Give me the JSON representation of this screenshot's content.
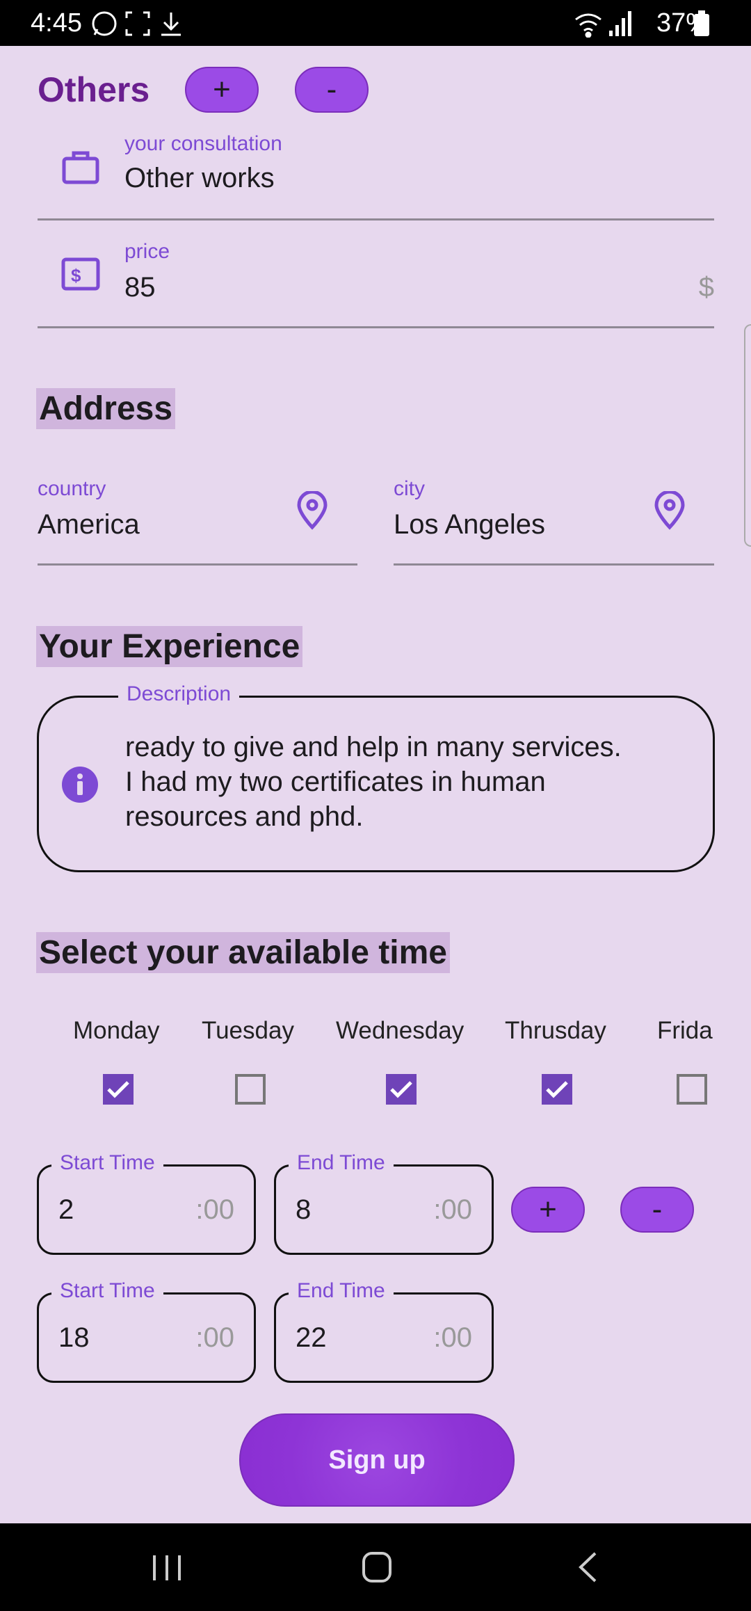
{
  "status_bar": {
    "time": "4:45",
    "battery": "37%"
  },
  "others": {
    "title": "Others",
    "add_label": "+",
    "remove_label": "-"
  },
  "consultation": {
    "label": "your consultation",
    "value": "Other works",
    "icon": "briefcase-icon"
  },
  "price": {
    "label": "price",
    "value": "85",
    "suffix": "$",
    "icon": "money-icon"
  },
  "address": {
    "title": "Address",
    "country": {
      "label": "country",
      "value": "America",
      "icon": "location-pin-icon"
    },
    "city": {
      "label": "city",
      "value": "Los Angeles",
      "icon": "location-pin-icon"
    }
  },
  "experience": {
    "title": "Your Experience",
    "description_label": "Description",
    "description_lines": [
      "ready to give and help in many services.",
      "I had my two certificates in human",
      "resources and phd."
    ],
    "icon": "info-icon"
  },
  "availability": {
    "title": "Select your available time",
    "days": [
      {
        "label": "Monday",
        "checked": true
      },
      {
        "label": "Tuesday",
        "checked": false
      },
      {
        "label": "Wednesday",
        "checked": true
      },
      {
        "label": "Thrusday",
        "checked": true
      },
      {
        "label": "Frida",
        "checked": false
      }
    ],
    "slots": [
      {
        "start_label": "Start Time",
        "start_value": "2",
        "end_label": "End Time",
        "end_value": "8",
        "suffix": ":00"
      },
      {
        "start_label": "Start Time",
        "start_value": "18",
        "end_label": "End Time",
        "end_value": "22",
        "suffix": ":00"
      }
    ],
    "add_label": "+",
    "remove_label": "-"
  },
  "signup_label": "Sign up",
  "colors": {
    "accent": "#7d4ad4",
    "button": "#9b4be6",
    "background": "#e7d8ee",
    "highlight": "#d0b5dd"
  }
}
